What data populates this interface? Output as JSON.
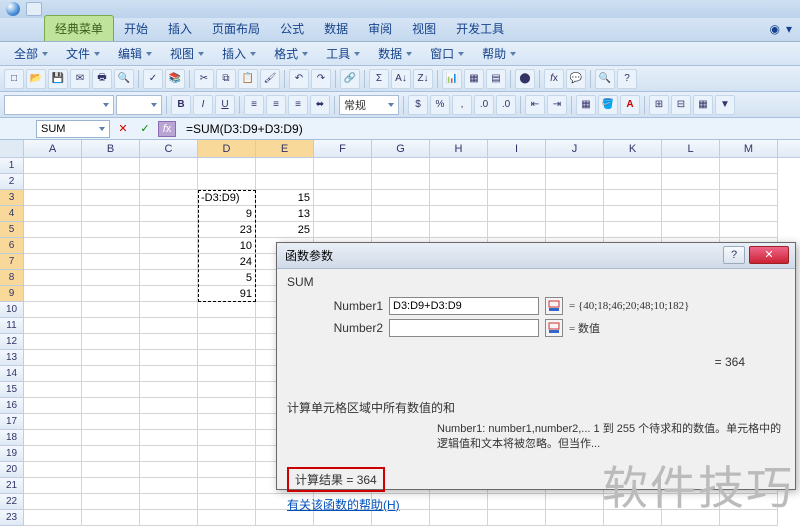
{
  "tabs": [
    "经典菜单",
    "开始",
    "插入",
    "页面布局",
    "公式",
    "数据",
    "审阅",
    "视图",
    "开发工具"
  ],
  "active_tab": 0,
  "menus": [
    "全部",
    "文件",
    "编辑",
    "视图",
    "插入",
    "格式",
    "工具",
    "数据",
    "窗口",
    "帮助"
  ],
  "namebox": "SUM",
  "formula": "=SUM(D3:D9+D3:D9)",
  "font_style": "常规",
  "columns": [
    "A",
    "B",
    "C",
    "D",
    "E",
    "F",
    "G",
    "H",
    "I",
    "J",
    "K",
    "L",
    "M"
  ],
  "row_count": 23,
  "cells": {
    "D3": "-D3:D9)",
    "D4": "9",
    "D5": "23",
    "D6": "10",
    "D7": "24",
    "D8": "5",
    "D9": "91",
    "E3": "15",
    "E4": "13",
    "E5": "25"
  },
  "cell_align": {
    "D3": "left"
  },
  "selected_cols": [
    "D",
    "E"
  ],
  "selected_rows": [
    3,
    4,
    5,
    6,
    7,
    8,
    9
  ],
  "marquee": {
    "col": "D",
    "row_start": 3,
    "row_end": 9
  },
  "dialog": {
    "title": "函数参数",
    "fn": "SUM",
    "args": [
      {
        "label": "Number1",
        "value": "D3:D9+D3:D9",
        "result": "= {40;18;46;20;48;10;182}"
      },
      {
        "label": "Number2",
        "value": "",
        "result": "= 数值"
      }
    ],
    "preview_eq": "= 364",
    "description": "计算单元格区域中所有数值的和",
    "arg_desc_label": "Number1:",
    "arg_desc": "number1,number2,... 1 到 255 个待求和的数值。单元格中的逻辑值和文本将被忽略。但当作...",
    "result_label": "计算结果 = ",
    "result_value": "364",
    "help_link": "有关该函数的帮助(H)"
  },
  "watermark": "软件技巧"
}
